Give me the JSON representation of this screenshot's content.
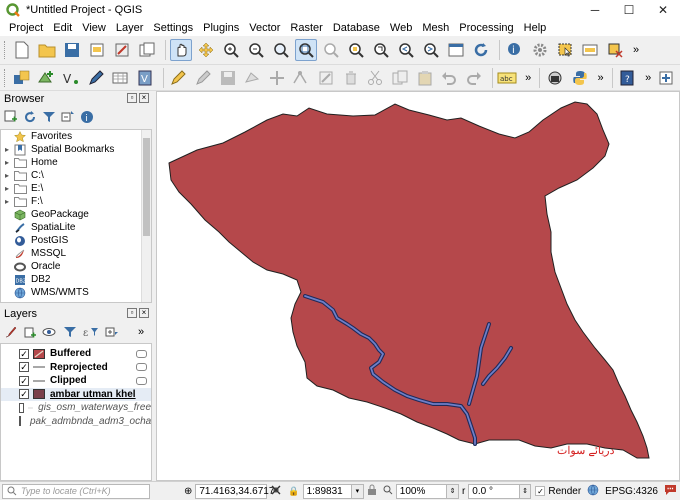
{
  "window": {
    "title": "*Untitled Project - QGIS",
    "minimize": "─",
    "maximize": "☐",
    "close": "✕"
  },
  "menu": [
    "Project",
    "Edit",
    "View",
    "Layer",
    "Settings",
    "Plugins",
    "Vector",
    "Raster",
    "Database",
    "Web",
    "Mesh",
    "Processing",
    "Help"
  ],
  "toolbar_more": "»",
  "browser": {
    "title": "Browser",
    "items": [
      {
        "label": "Favorites",
        "icon": "star-icon",
        "arrow": ""
      },
      {
        "label": "Spatial Bookmarks",
        "icon": "bookmark-icon",
        "arrow": "▸"
      },
      {
        "label": "Home",
        "icon": "folder-icon",
        "arrow": "▸"
      },
      {
        "label": "C:\\",
        "icon": "folder-icon",
        "arrow": "▸"
      },
      {
        "label": "E:\\",
        "icon": "folder-icon",
        "arrow": "▸"
      },
      {
        "label": "F:\\",
        "icon": "folder-icon",
        "arrow": "▸"
      },
      {
        "label": "GeoPackage",
        "icon": "geopackage-icon",
        "arrow": ""
      },
      {
        "label": "SpatiaLite",
        "icon": "spatialite-icon",
        "arrow": ""
      },
      {
        "label": "PostGIS",
        "icon": "postgis-icon",
        "arrow": ""
      },
      {
        "label": "MSSQL",
        "icon": "mssql-icon",
        "arrow": ""
      },
      {
        "label": "Oracle",
        "icon": "oracle-icon",
        "arrow": ""
      },
      {
        "label": "DB2",
        "icon": "db2-icon",
        "arrow": ""
      },
      {
        "label": "WMS/WMTS",
        "icon": "wms-icon",
        "arrow": ""
      }
    ]
  },
  "layers": {
    "title": "Layers",
    "items": [
      {
        "label": "Buffered",
        "checked": true,
        "style": "bold",
        "symbol": "polygon-red"
      },
      {
        "label": "Reprojected",
        "checked": true,
        "style": "bold",
        "symbol": "line-gray"
      },
      {
        "label": "Clipped",
        "checked": true,
        "style": "bold",
        "symbol": "line-gray"
      },
      {
        "label": "ambar utman khel",
        "checked": true,
        "style": "bold",
        "symbol": "polygon-dark"
      },
      {
        "label": "gis_osm_waterways_free",
        "checked": false,
        "style": "italic",
        "symbol": "line-light"
      },
      {
        "label": "pak_admbnda_adm3_ocha",
        "checked": false,
        "style": "italic",
        "symbol": "polygon-purple"
      }
    ]
  },
  "map": {
    "polygon_fill": "#b5484b",
    "river_color": "#4a5aa8",
    "label": "دریائے سوات"
  },
  "status": {
    "locate_placeholder": "Type to locate (Ctrl+K)",
    "coordinate": "71.4163,34.6717",
    "scale": "1:89831",
    "magnifier": "100%",
    "rotation": "0.0 °",
    "render_label": "Render",
    "crs": "EPSG:4326",
    "coordinate_icon": "⊕",
    "scale_icon": "🔒",
    "rotation_icon": "r",
    "render_checked": "✓"
  },
  "colors": {
    "accent": "#7da2ce",
    "polygon": "#b5484b"
  }
}
